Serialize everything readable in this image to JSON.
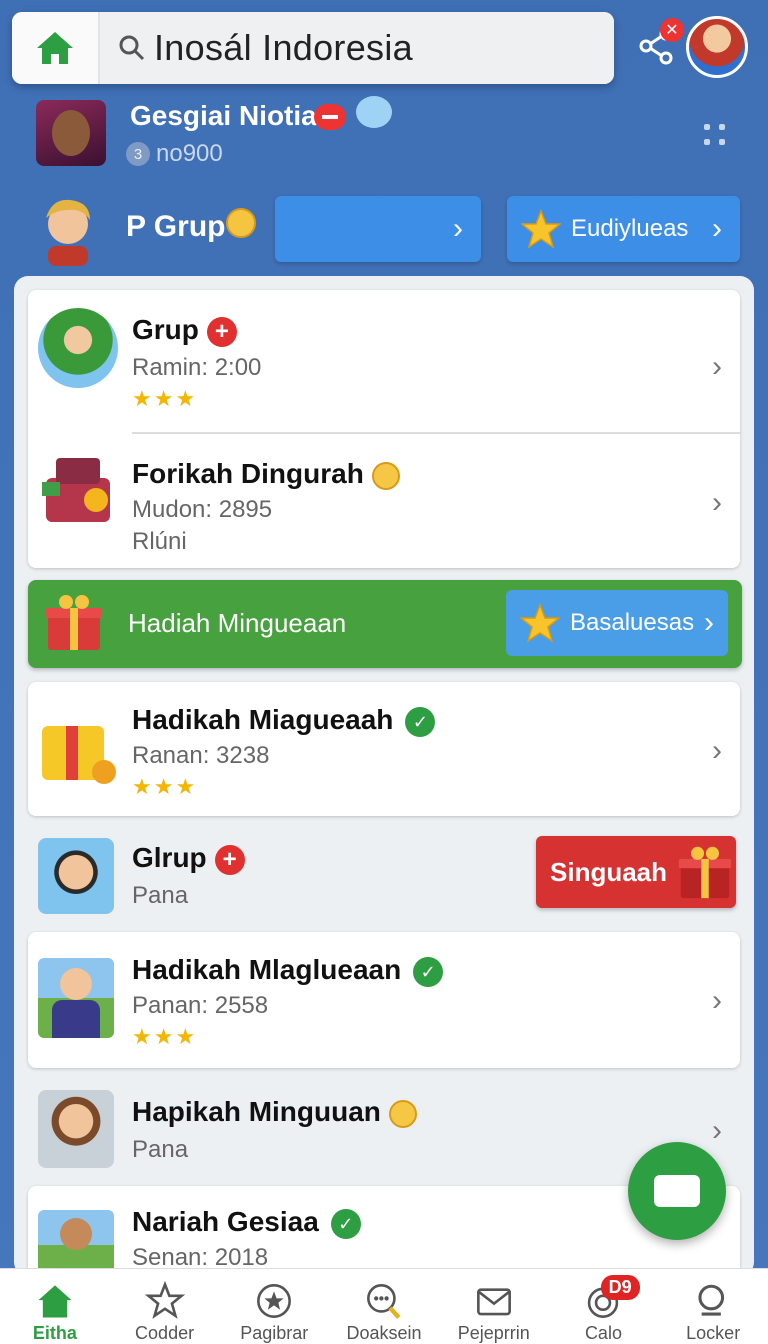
{
  "search": {
    "text": "Inosál Indoresia"
  },
  "header": {
    "share_badge": "✕"
  },
  "profile": {
    "name": "Gesgiai Niotia",
    "sub_number": "3",
    "sub_text": "no900"
  },
  "group_row": {
    "label": "P Grup",
    "button2_label": "Eudiylueas"
  },
  "items": [
    {
      "title": "Grup",
      "sub": "Ramin: 2:00",
      "stars": "★★★"
    },
    {
      "title": "Forikah Dingurah",
      "sub": "Mudon: 2895",
      "sub2": "Rlúni"
    },
    {
      "title": "Hadikah Miagueaah",
      "sub": "Ranan: 3238",
      "stars": "★★★"
    },
    {
      "title": "Glrup",
      "sub": "Pana"
    },
    {
      "title": "Hadikah Mlaglueaan",
      "sub": "Panan: 2558",
      "stars": "★★★"
    },
    {
      "title": "Hapikah Minguuan",
      "sub": "Pana"
    },
    {
      "title": "Nariah Gesiaa",
      "sub": "Senan: 2018"
    }
  ],
  "banner": {
    "text": "Hadiah Mingueaan",
    "button_label": "Basaluesas"
  },
  "red_button": {
    "label": "Singuaah"
  },
  "nav": [
    {
      "label": "Eitha"
    },
    {
      "label": "Codder"
    },
    {
      "label": "Pagibrar"
    },
    {
      "label": "Doaksein"
    },
    {
      "label": "Pejeprrin"
    },
    {
      "label": "Calo",
      "badge": "D9"
    },
    {
      "label": "Locker"
    }
  ],
  "colors": {
    "primary_green": "#2e9e43",
    "header_blue": "#4677bd",
    "accent_red": "#d63232",
    "button_blue": "#3d8ee6"
  }
}
